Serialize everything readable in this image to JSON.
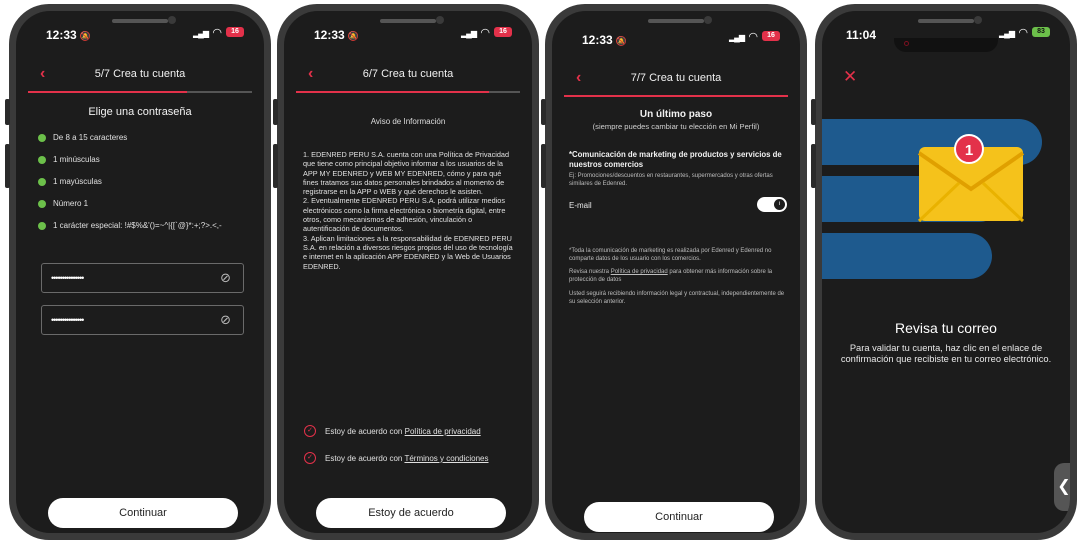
{
  "screens": [
    {
      "time": "12:33",
      "battery": "16",
      "header_title": "5/7 Crea tu cuenta",
      "progress": 0.71,
      "title": "Elige una contraseña",
      "requirements": [
        "De 8 a 15 caracteres",
        "1 minúsculas",
        "1 mayúsculas",
        "Número 1",
        "1 carácter especial: !#$%&'()=~^|{[`@}*:+;?>.<,-"
      ],
      "password_value": "•••••••••••••••",
      "confirm_password_value": "•••••••••••••••",
      "button": "Continuar"
    },
    {
      "time": "12:33",
      "battery": "16",
      "header_title": "6/7 Crea tu cuenta",
      "progress": 0.86,
      "subtitle": "Aviso de Información",
      "body": "1. EDENRED PERU S.A. cuenta con una Política de Privacidad que tiene como principal objetivo informar a los usuarios de la APP MY EDENRED y WEB MY EDENRED, cómo y para qué fines tratamos sus datos personales brindados al momento de registrarse en la APP o WEB y qué derechos le asisten.\n2. Eventualmente EDENRED PERU S.A. podrá utilizar medios electrónicos como la firma electrónica o biometría digital, entre otros, como mecanismos de adhesión, vinculación o autentificación de documentos.\n3. Aplican limitaciones a la responsabilidad de EDENRED PERU S.A. en relación a diversos riesgos propios del uso de tecnología e internet en la aplicación APP EDENRED y la Web de Usuarios EDENRED.",
      "agree_prefix": "Estoy de acuerdo con",
      "privacy_link": "Política de privacidad",
      "terms_link": "Términos y condiciones",
      "button": "Estoy de acuerdo"
    },
    {
      "time": "12:33",
      "battery": "16",
      "header_title": "7/7 Crea tu cuenta",
      "progress": 1.0,
      "title": "Un último paso",
      "subtitle": "(siempre puedes cambiar tu elección en Mi Perfil)",
      "marketing_title": "*Comunicación de marketing de productos y servicios de nuestros comercios",
      "marketing_example": "Ej: Promociones/descuentos en restaurantes, supermercados y otras ofertas similares de Edenred.",
      "email_label": "E-mail",
      "toggle_on": true,
      "note_marketing": "*Toda la comunicación de marketing es realizada por Edenred y Edenred no comparte datos de los usuario con los comercios.",
      "note_privacy_prefix": "Revisa nuestra ",
      "note_privacy_link": "Política de privacidad",
      "note_privacy_suffix": " para obtener más información sobre la protección de datos",
      "note_legal": "Usted seguirá recibiendo información legal y contractual, independientemente de su selección anterior.",
      "button": "Continuar"
    },
    {
      "time": "11:04",
      "battery": "83",
      "badge_count": "1",
      "title": "Revisa tu correo",
      "body": "Para validar tu cuenta, haz clic en el enlace de confirmación que recibiste en tu correo electrónico.",
      "side_handle": "❮"
    }
  ],
  "icons": {
    "back": "chevron-left-icon",
    "eye_off": "eye-off-icon",
    "close": "close-icon",
    "envelope": "envelope-icon",
    "check_circle": "check-circle-icon"
  },
  "colors": {
    "accent": "#e3314a",
    "screen_bg": "#1c1c1c",
    "success": "#6cc04a",
    "band_blue": "#1e5a8e",
    "envelope_yellow": "#f5c21b"
  }
}
